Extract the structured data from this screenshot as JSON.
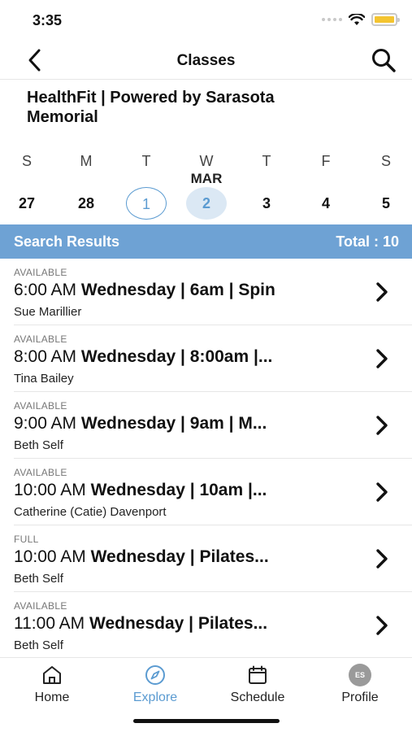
{
  "status_bar": {
    "time": "3:35"
  },
  "nav": {
    "title": "Classes"
  },
  "org": {
    "name": "HealthFit | Powered by Sarasota Memorial"
  },
  "calendar": {
    "month": "MAR",
    "days": [
      {
        "dow": "S",
        "date": "27"
      },
      {
        "dow": "M",
        "date": "28"
      },
      {
        "dow": "T",
        "date": "1"
      },
      {
        "dow": "W",
        "date": "2"
      },
      {
        "dow": "T",
        "date": "3"
      },
      {
        "dow": "F",
        "date": "4"
      },
      {
        "dow": "S",
        "date": "5"
      }
    ]
  },
  "results": {
    "title": "Search Results",
    "total": "Total : 10"
  },
  "classes": [
    {
      "status": "AVAILABLE",
      "time": "6:00 AM",
      "name": "Wednesday | 6am | Spin",
      "instructor": "Sue Marillier"
    },
    {
      "status": "AVAILABLE",
      "time": "8:00 AM",
      "name": "Wednesday | 8:00am |...",
      "instructor": "Tina Bailey"
    },
    {
      "status": "AVAILABLE",
      "time": "9:00 AM",
      "name": "Wednesday | 9am | M...",
      "instructor": "Beth Self"
    },
    {
      "status": "AVAILABLE",
      "time": "10:00 AM",
      "name": "Wednesday | 10am |...",
      "instructor": "Catherine (Catie) Davenport"
    },
    {
      "status": "FULL",
      "time": "10:00 AM",
      "name": "Wednesday | Pilates...",
      "instructor": "Beth Self"
    },
    {
      "status": "AVAILABLE",
      "time": "11:00 AM",
      "name": "Wednesday | Pilates...",
      "instructor": "Beth Self"
    }
  ],
  "tabs": [
    {
      "label": "Home",
      "icon": "home-icon"
    },
    {
      "label": "Explore",
      "icon": "compass-icon",
      "active": true
    },
    {
      "label": "Schedule",
      "icon": "calendar-icon"
    },
    {
      "label": "Profile",
      "icon": "avatar",
      "initials": "ES"
    }
  ],
  "colors": {
    "accent": "#5b9bd1",
    "results_bar": "#6ea2d4",
    "selected_day_bg": "#dbe8f4",
    "battery": "#f4c430"
  }
}
